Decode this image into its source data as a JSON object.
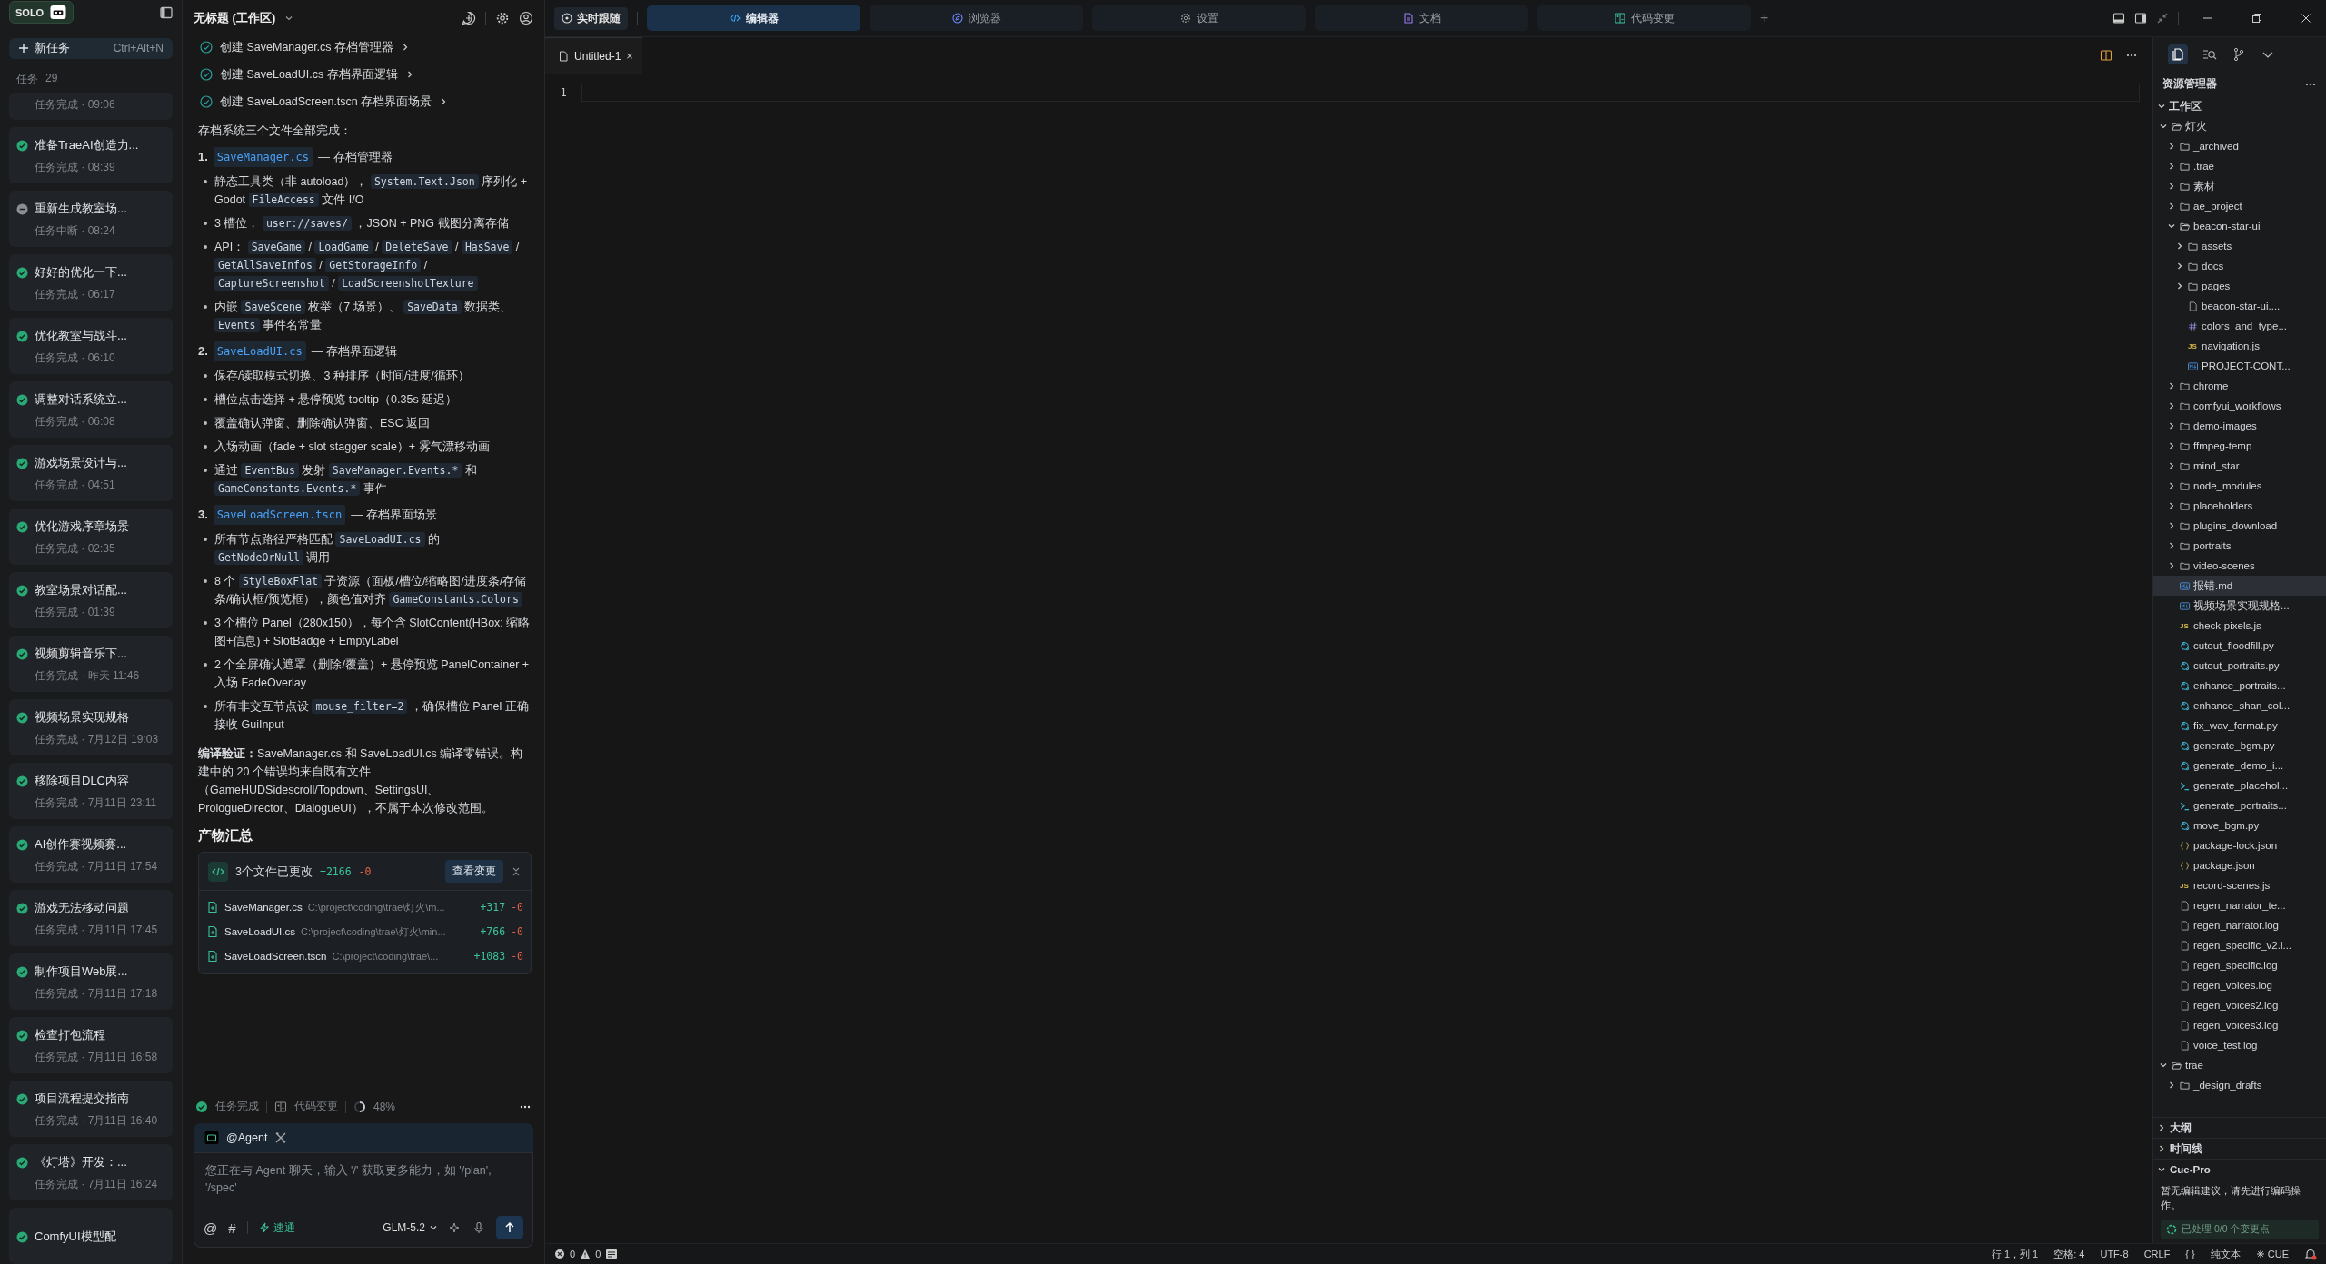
{
  "sidebar": {
    "badge": "SOLO",
    "new_task": {
      "label": "新任务",
      "shortcut": "Ctrl+Alt+N"
    },
    "task_header": {
      "label": "任务",
      "count": "29"
    },
    "tasks": [
      {
        "meta": "任务完成 · 09:06",
        "selected": false
      },
      {
        "title": "准备TraeAI创造力...",
        "meta": "任务完成 · 08:39",
        "kind": "done",
        "selected": false
      },
      {
        "title": "重新生成教室场...",
        "meta": "任务中断 · 08:24",
        "kind": "interrupted",
        "selected": false
      },
      {
        "title": "好好的优化一下...",
        "meta": "任务完成 · 06:17",
        "kind": "done",
        "selected": false
      },
      {
        "title": "优化教室与战斗...",
        "meta": "任务完成 · 06:10",
        "kind": "done",
        "selected": false
      },
      {
        "title": "调整对话系统立...",
        "meta": "任务完成 · 06:08",
        "kind": "done",
        "selected": false
      },
      {
        "title": "游戏场景设计与...",
        "meta": "任务完成 · 04:51",
        "kind": "done",
        "selected": false
      },
      {
        "title": "优化游戏序章场景",
        "meta": "任务完成 · 02:35",
        "kind": "done",
        "selected": false
      },
      {
        "title": "教室场景对话配...",
        "meta": "任务完成 · 01:39",
        "kind": "done",
        "selected": false
      },
      {
        "title": "视频剪辑音乐下...",
        "meta": "任务完成 · 昨天 11:46",
        "kind": "done",
        "selected": false
      },
      {
        "title": "视频场景实现规格",
        "meta": "任务完成 · 7月12日 19:03",
        "kind": "done",
        "selected": false
      },
      {
        "title": "移除项目DLC内容",
        "meta": "任务完成 · 7月11日 23:11",
        "kind": "done",
        "selected": false
      },
      {
        "title": "AI创作赛视频赛...",
        "meta": "任务完成 · 7月11日 17:54",
        "kind": "done",
        "selected": false
      },
      {
        "title": "游戏无法移动问题",
        "meta": "任务完成 · 7月11日 17:45",
        "kind": "done",
        "selected": false
      },
      {
        "title": "制作项目Web展...",
        "meta": "任务完成 · 7月11日 17:18",
        "kind": "done",
        "selected": false
      },
      {
        "title": "检查打包流程",
        "meta": "任务完成 · 7月11日 16:58",
        "kind": "done",
        "selected": false
      },
      {
        "title": "项目流程提交指南",
        "meta": "任务完成 · 7月11日 16:40",
        "kind": "done",
        "selected": false
      },
      {
        "title": "《灯塔》开发：...",
        "meta": "任务完成 · 7月11日 16:24",
        "kind": "done",
        "selected": false
      },
      {
        "title": "ComfyUI模型配",
        "kind": "done",
        "selected": false
      }
    ]
  },
  "chat": {
    "title": "无标题 (工作区)",
    "steps": [
      "创建 SaveManager.cs 存档管理器",
      "创建 SaveLoadUI.cs 存档界面逻辑",
      "创建 SaveLoadScreen.tscn 存档界面场景"
    ],
    "intro": "存档系统三个文件全部完成：",
    "sections": [
      {
        "num": "1.",
        "file": "SaveManager.cs",
        "desc": "— 存档管理器",
        "bullets": [
          [
            {
              "kind": "text",
              "text": "静态工具类（非 autoload）， "
            },
            {
              "kind": "code",
              "text": "System.Text.Json"
            },
            {
              "kind": "text",
              "text": " 序列化 + Godot "
            },
            {
              "kind": "code",
              "text": "FileAccess"
            },
            {
              "kind": "text",
              "text": " 文件 I/O"
            }
          ],
          [
            {
              "kind": "text",
              "text": "3 槽位， "
            },
            {
              "kind": "code",
              "text": "user://saves/"
            },
            {
              "kind": "text",
              "text": " ，JSON + PNG 截图分离存储"
            }
          ],
          [
            {
              "kind": "text",
              "text": "API： "
            },
            {
              "kind": "code",
              "text": "SaveGame"
            },
            {
              "kind": "text",
              "text": " / "
            },
            {
              "kind": "code",
              "text": "LoadGame"
            },
            {
              "kind": "text",
              "text": " / "
            },
            {
              "kind": "code",
              "text": "DeleteSave"
            },
            {
              "kind": "text",
              "text": " / "
            },
            {
              "kind": "code",
              "text": "HasSave"
            },
            {
              "kind": "text",
              "text": " / "
            },
            {
              "kind": "code",
              "text": "GetAllSaveInfos"
            },
            {
              "kind": "text",
              "text": " / "
            },
            {
              "kind": "code",
              "text": "GetStorageInfo"
            },
            {
              "kind": "text",
              "text": " / "
            },
            {
              "kind": "code",
              "text": "CaptureScreenshot"
            },
            {
              "kind": "text",
              "text": " / "
            },
            {
              "kind": "code",
              "text": "LoadScreenshotTexture"
            }
          ],
          [
            {
              "kind": "text",
              "text": "内嵌 "
            },
            {
              "kind": "code",
              "text": "SaveScene"
            },
            {
              "kind": "text",
              "text": " 枚举（7 场景）、 "
            },
            {
              "kind": "code",
              "text": "SaveData"
            },
            {
              "kind": "text",
              "text": " 数据类、 "
            },
            {
              "kind": "code",
              "text": "Events"
            },
            {
              "kind": "text",
              "text": " 事件名常量"
            }
          ]
        ]
      },
      {
        "num": "2.",
        "file": "SaveLoadUI.cs",
        "desc": "— 存档界面逻辑",
        "bullets": [
          [
            {
              "kind": "text",
              "text": "保存/读取模式切换、3 种排序（时间/进度/循环）"
            }
          ],
          [
            {
              "kind": "text",
              "text": "槽位点击选择 + 悬停预览 tooltip（0.35s 延迟）"
            }
          ],
          [
            {
              "kind": "text",
              "text": "覆盖确认弹窗、删除确认弹窗、ESC 返回"
            }
          ],
          [
            {
              "kind": "text",
              "text": "入场动画（fade + slot stagger scale）+ 雾气漂移动画"
            }
          ],
          [
            {
              "kind": "text",
              "text": "通过 "
            },
            {
              "kind": "code",
              "text": "EventBus"
            },
            {
              "kind": "text",
              "text": " 发射 "
            },
            {
              "kind": "code",
              "text": "SaveManager.Events.*"
            },
            {
              "kind": "text",
              "text": " 和 "
            },
            {
              "kind": "code",
              "text": "GameConstants.Events.*"
            },
            {
              "kind": "text",
              "text": " 事件"
            }
          ]
        ]
      },
      {
        "num": "3.",
        "file": "SaveLoadScreen.tscn",
        "desc": "— 存档界面场景",
        "bullets": [
          [
            {
              "kind": "text",
              "text": "所有节点路径严格匹配 "
            },
            {
              "kind": "code",
              "text": "SaveLoadUI.cs"
            },
            {
              "kind": "text",
              "text": " 的 "
            },
            {
              "kind": "code",
              "text": "GetNodeOrNull"
            },
            {
              "kind": "text",
              "text": " 调用"
            }
          ],
          [
            {
              "kind": "text",
              "text": "8 个 "
            },
            {
              "kind": "code",
              "text": "StyleBoxFlat"
            },
            {
              "kind": "text",
              "text": " 子资源（面板/槽位/缩略图/进度条/存储条/确认框/预览框），颜色值对齐 "
            },
            {
              "kind": "code",
              "text": "GameConstants.Colors"
            }
          ],
          [
            {
              "kind": "text",
              "text": "3 个槽位 Panel（280x150），每个含 SlotContent(HBox: 缩略图+信息) + SlotBadge + EmptyLabel"
            }
          ],
          [
            {
              "kind": "text",
              "text": "2 个全屏确认遮罩（删除/覆盖）+ 悬停预览 PanelContainer + 入场 FadeOverlay"
            }
          ],
          [
            {
              "kind": "text",
              "text": "所有非交互节点设 "
            },
            {
              "kind": "code",
              "text": "mouse_filter=2"
            },
            {
              "kind": "text",
              "text": " ，确保槽位 Panel 正确接收 GuiInput"
            }
          ]
        ]
      }
    ],
    "summary": "**编译验证：**SaveManager.cs 和 SaveLoadUI.cs 编译零错误。构建中的 20 个错误均来自既有文件（GameHUDSidescroll/Topdown、SettingsUI、PrologueDirector、DialogueUI），不属于本次修改范围。",
    "heading": "产物汇总",
    "changes": {
      "title": "3个文件已更改",
      "added": "+2166",
      "removed": "-0",
      "button": "查看变更",
      "files": [
        {
          "name": "SaveManager.cs",
          "path": "C:\\project\\coding\\trae\\灯火\\m...",
          "added": "+317",
          "removed": "-0"
        },
        {
          "name": "SaveLoadUI.cs",
          "path": "C:\\project\\coding\\trae\\灯火\\min...",
          "added": "+766",
          "removed": "-0"
        },
        {
          "name": "SaveLoadScreen.tscn",
          "path": "C:\\project\\coding\\trae\\...",
          "added": "+1083",
          "removed": "-0"
        }
      ]
    },
    "footer": {
      "status": "任务完成",
      "changes": "代码变更",
      "progress": "48%"
    },
    "input": {
      "agent": "@Agent",
      "placeholder": "您正在与 Agent 聊天，输入 '/' 获取更多能力，如 '/plan', '/spec'",
      "at": "@",
      "hash": "#",
      "mode": "速通",
      "model": "GLM-5.2"
    }
  },
  "topbar": {
    "follow": "实时跟随",
    "tabs": [
      {
        "label": "编辑器",
        "kind": "code",
        "selected": true
      },
      {
        "label": "浏览器",
        "kind": "globe",
        "selected": false
      },
      {
        "label": "设置",
        "kind": "gear",
        "selected": false
      },
      {
        "label": "文档",
        "kind": "doc",
        "selected": false
      },
      {
        "label": "代码变更",
        "kind": "diff",
        "selected": false
      }
    ],
    "add": "+"
  },
  "editor": {
    "tab": {
      "label": "Untitled-1",
      "close": "×"
    },
    "line": "1"
  },
  "explorer": {
    "title": "资源管理器",
    "workspace": {
      "label": "工作区",
      "expanded": true,
      "tree": [
        {
          "name": "灯火",
          "kind": "folder",
          "expanded": true,
          "selected": false,
          "children": [
            {
              "name": "_archived",
              "kind": "folder",
              "expanded": false,
              "selected": false
            },
            {
              "name": ".trae",
              "kind": "folder",
              "expanded": false,
              "selected": false
            },
            {
              "name": "素材",
              "kind": "folder",
              "expanded": false,
              "selected": false
            },
            {
              "name": "ae_project",
              "kind": "folder",
              "expanded": false,
              "selected": false
            },
            {
              "name": "beacon-star-ui",
              "kind": "folder",
              "expanded": true,
              "selected": false,
              "children": [
                {
                  "name": "assets",
                  "kind": "folder",
                  "expanded": false,
                  "selected": false
                },
                {
                  "name": "docs",
                  "kind": "folder",
                  "expanded": false,
                  "selected": false
                },
                {
                  "name": "pages",
                  "kind": "folder",
                  "expanded": false,
                  "selected": false
                },
                {
                  "name": "beacon-star-ui....",
                  "kind": "file",
                  "selected": false
                },
                {
                  "name": "colors_and_type...",
                  "kind": "hash",
                  "selected": false
                },
                {
                  "name": "navigation.js",
                  "kind": "js",
                  "badge": "JS",
                  "selected": false
                },
                {
                  "name": "PROJECT-CONT...",
                  "kind": "md",
                  "selected": false
                }
              ]
            },
            {
              "name": "chrome",
              "kind": "folder",
              "expanded": false,
              "selected": false
            },
            {
              "name": "comfyui_workflows",
              "kind": "folder",
              "expanded": false,
              "selected": false
            },
            {
              "name": "demo-images",
              "kind": "folder",
              "expanded": false,
              "selected": false
            },
            {
              "name": "ffmpeg-temp",
              "kind": "folder",
              "expanded": false,
              "selected": false
            },
            {
              "name": "mind_star",
              "kind": "folder",
              "expanded": false,
              "selected": false
            },
            {
              "name": "node_modules",
              "kind": "folder",
              "expanded": false,
              "selected": false
            },
            {
              "name": "placeholders",
              "kind": "folder",
              "expanded": false,
              "selected": false
            },
            {
              "name": "plugins_download",
              "kind": "folder",
              "expanded": false,
              "selected": false
            },
            {
              "name": "portraits",
              "kind": "folder",
              "expanded": false,
              "selected": false
            },
            {
              "name": "video-scenes",
              "kind": "folder",
              "expanded": false,
              "selected": false
            },
            {
              "name": "报错.md",
              "kind": "md",
              "selected": true
            },
            {
              "name": "视频场景实现规格...",
              "kind": "md",
              "selected": false
            },
            {
              "name": "check-pixels.js",
              "kind": "js",
              "badge": "JS",
              "selected": false
            },
            {
              "name": "cutout_floodfill.py",
              "kind": "py",
              "selected": false
            },
            {
              "name": "cutout_portraits.py",
              "kind": "py",
              "selected": false
            },
            {
              "name": "enhance_portraits...",
              "kind": "py",
              "selected": false
            },
            {
              "name": "enhance_shan_col...",
              "kind": "py",
              "selected": false
            },
            {
              "name": "fix_wav_format.py",
              "kind": "py",
              "selected": false
            },
            {
              "name": "generate_bgm.py",
              "kind": "py",
              "selected": false
            },
            {
              "name": "generate_demo_i...",
              "kind": "py",
              "selected": false
            },
            {
              "name": "generate_placehol...",
              "kind": "terminal",
              "selected": false
            },
            {
              "name": "generate_portraits...",
              "kind": "terminal",
              "selected": false
            },
            {
              "name": "move_bgm.py",
              "kind": "py",
              "selected": false
            },
            {
              "name": "package-lock.json",
              "kind": "json",
              "selected": false
            },
            {
              "name": "package.json",
              "kind": "json",
              "selected": false
            },
            {
              "name": "record-scenes.js",
              "kind": "js",
              "badge": "JS",
              "selected": false
            },
            {
              "name": "regen_narrator_te...",
              "kind": "file",
              "selected": false
            },
            {
              "name": "regen_narrator.log",
              "kind": "file",
              "selected": false
            },
            {
              "name": "regen_specific_v2.l...",
              "kind": "file",
              "selected": false
            },
            {
              "name": "regen_specific.log",
              "kind": "file",
              "selected": false
            },
            {
              "name": "regen_voices.log",
              "kind": "file",
              "selected": false
            },
            {
              "name": "regen_voices2.log",
              "kind": "file",
              "selected": false
            },
            {
              "name": "regen_voices3.log",
              "kind": "file",
              "selected": false
            },
            {
              "name": "voice_test.log",
              "kind": "file",
              "selected": false
            }
          ]
        },
        {
          "name": "trae",
          "kind": "folder",
          "expanded": true,
          "selected": false,
          "children": [
            {
              "name": "_design_drafts",
              "kind": "folder",
              "expanded": false,
              "selected": false
            }
          ]
        }
      ]
    },
    "panels": [
      {
        "label": "大纲",
        "expanded": false
      },
      {
        "label": "时间线",
        "expanded": false
      },
      {
        "label": "Cue-Pro",
        "expanded": true
      }
    ],
    "cue": {
      "message": "暂无编辑建议，请先进行编码操作。",
      "processed": "已处理 0/0 个变更点"
    }
  },
  "statusbar": {
    "errors": "0",
    "warnings": "0",
    "items": [
      {
        "text": "行 1，列 1",
        "kind": "plain"
      },
      {
        "text": "空格: 4",
        "kind": "plain"
      },
      {
        "text": "UTF-8",
        "kind": "plain"
      },
      {
        "text": "CRLF",
        "kind": "plain"
      },
      {
        "text": "{ }",
        "kind": "plain"
      },
      {
        "text": "纯文本",
        "kind": "plain"
      },
      {
        "text": "CUE",
        "kind": "cue"
      }
    ]
  }
}
